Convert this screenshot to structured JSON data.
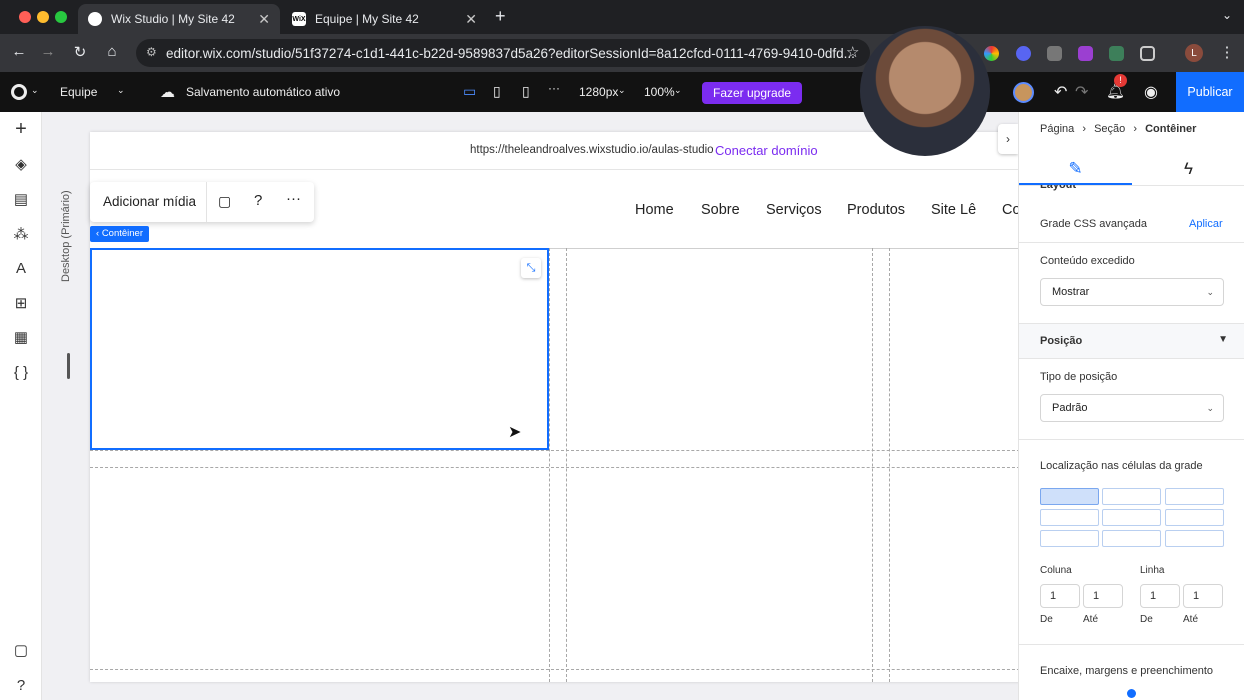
{
  "browser": {
    "tabs": [
      {
        "title": "Wix Studio | My Site 42",
        "active": true
      },
      {
        "title": "Equipe | My Site 42",
        "active": false
      }
    ],
    "url": "editor.wix.com/studio/51f37274-c1d1-441c-b22d-9589837d5a26?editorSessionId=8a12cfcd-0111-4769-9410-0dfd...",
    "profile_initial": "L"
  },
  "wix_bar": {
    "site_selector": "Equipe",
    "autosave": "Salvamento automático ativo",
    "viewport": "1280px",
    "zoom": "100%",
    "upgrade": "Fazer upgrade",
    "publish": "Publicar",
    "notification_count": "!"
  },
  "canvas": {
    "device_label": "Desktop (Primário)",
    "site_url": "https://theleandroalves.wixstudio.io/aulas-studio",
    "connect_domain": "Conectar domínio",
    "nav": [
      "Home",
      "Sobre",
      "Serviços",
      "Produtos",
      "Site Lê",
      "Co"
    ],
    "media_toolbar": {
      "add_media": "Adicionar mídia"
    },
    "container_tag": "Contêiner"
  },
  "panel": {
    "breadcrumb": [
      "Página",
      "Seção",
      "Contêiner"
    ],
    "layout_heading": "Layout",
    "advanced_grid": "Grade CSS avançada",
    "apply": "Aplicar",
    "overflow_label": "Conteúdo excedido",
    "overflow_value": "Mostrar",
    "position_heading": "Posição",
    "position_type_label": "Tipo de posição",
    "position_type_value": "Padrão",
    "grid_location_label": "Localização nas células da grade",
    "column_label": "Coluna",
    "row_label": "Linha",
    "column_from": "1",
    "column_to": "1",
    "row_from": "1",
    "row_to": "1",
    "from_label": "De",
    "to_label": "Até",
    "docking_label": "Encaixe, margens e preenchimento"
  }
}
